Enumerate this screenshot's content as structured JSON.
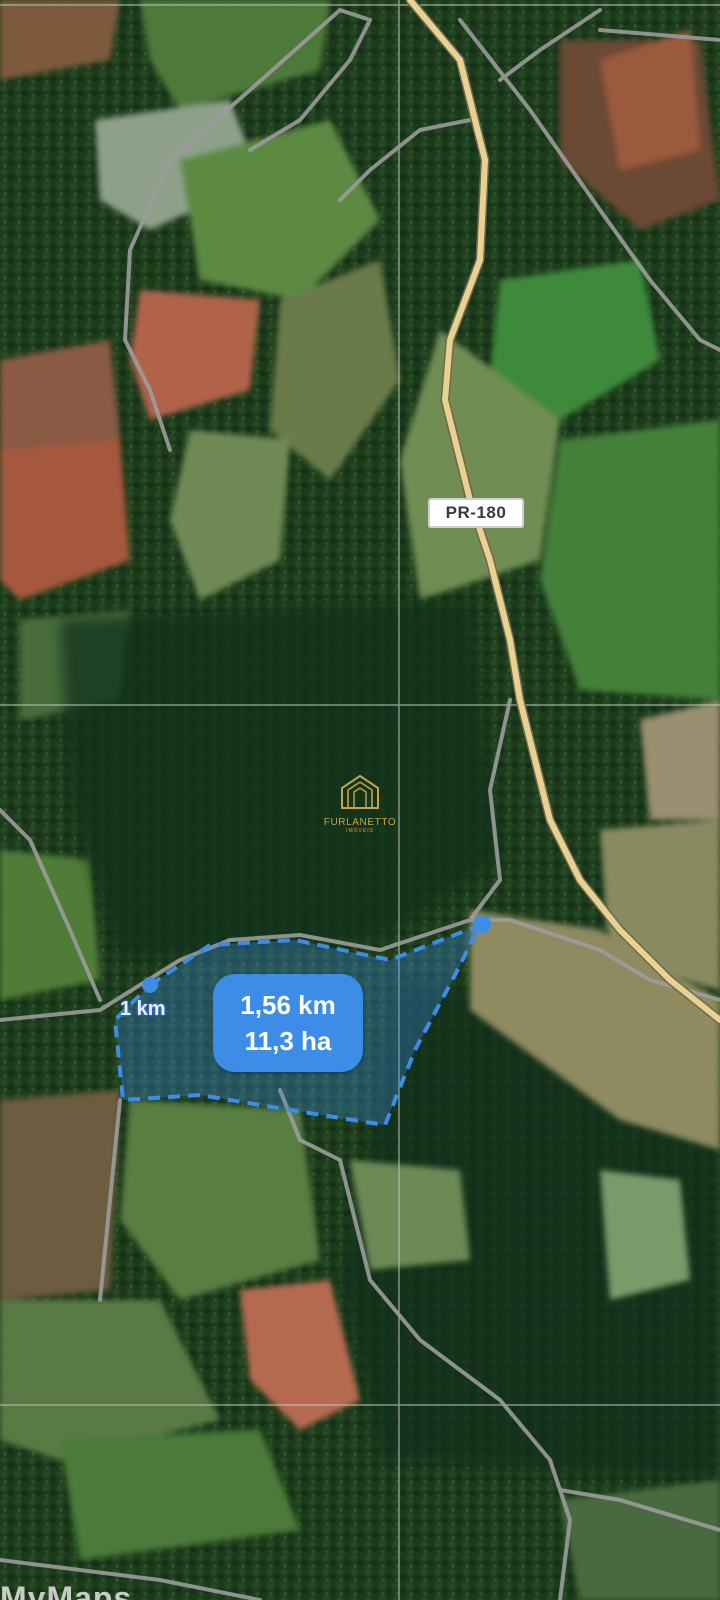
{
  "map": {
    "view": "satellite",
    "road_label": "PR-180",
    "measurement": {
      "distance": "1,56 km",
      "area": "11,3 ha",
      "segment_label": "1 km",
      "accent_color": "#3d8de8"
    },
    "watermark": {
      "brand": "FURLANETTO",
      "sub": "IMÓVEIS",
      "color": "#c9a24a"
    },
    "attribution": "MyMaps",
    "colors": {
      "highway": "#e9d28f",
      "roads": "#9c9c9c",
      "grid": "#c8c8c8",
      "forest": "#1c3a1a"
    }
  }
}
